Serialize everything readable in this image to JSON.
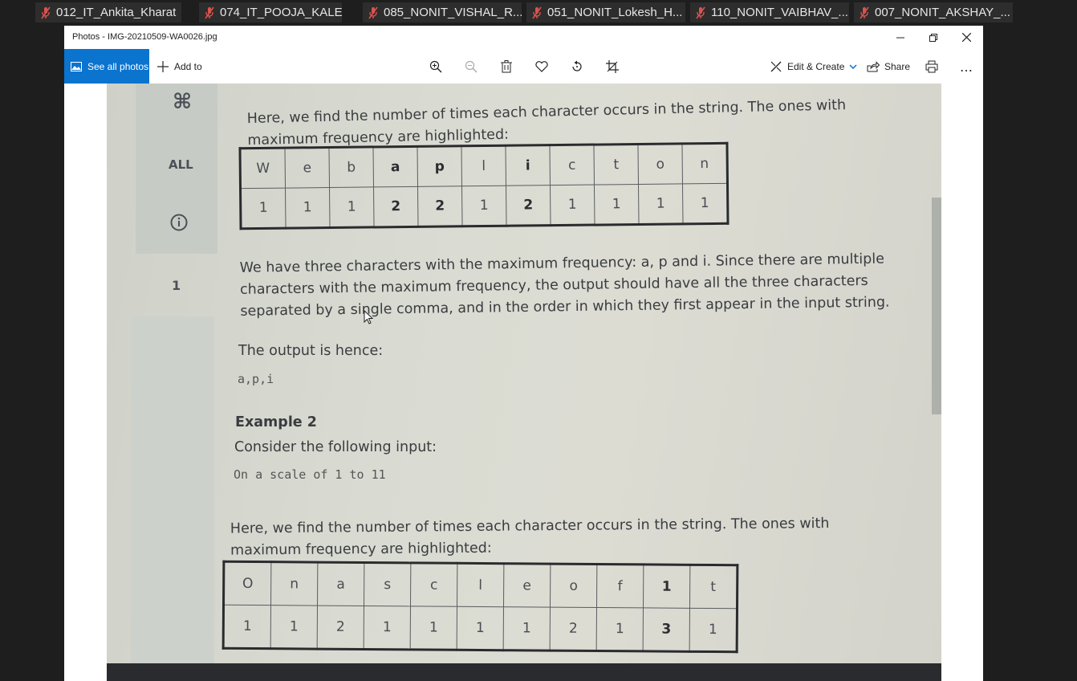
{
  "participants": [
    {
      "name": "012_IT_Ankita_Kharat"
    },
    {
      "name": "074_IT_POOJA_KALE"
    },
    {
      "name": "085_NONIT_VISHAL_R..."
    },
    {
      "name": "051_NONIT_Lokesh_H..."
    },
    {
      "name": "110_NONIT_VAIBHAV_..."
    },
    {
      "name": "007_NONIT_AKSHAY_..."
    }
  ],
  "window": {
    "title": "Photos - IMG-20210509-WA0026.jpg",
    "controls": {
      "minimize": "minimize-icon",
      "restore": "restore-icon",
      "close": "close-icon"
    }
  },
  "toolbar": {
    "see_all_photos": "See all photos",
    "add_to": "Add to",
    "edit_create": "Edit & Create",
    "share": "Share",
    "more": "…",
    "accent": "#0a74cf"
  },
  "page": {
    "sidebar": {
      "symbol": "⌘",
      "all": "ALL",
      "number": "1"
    },
    "para1": "Here, we find the number of times each character occurs in the string. The ones with maximum frequency are highlighted:",
    "table1": {
      "chars": [
        "W",
        "e",
        "b",
        "a",
        "p",
        "l",
        "i",
        "c",
        "t",
        "o",
        "n"
      ],
      "counts": [
        "1",
        "1",
        "1",
        "2",
        "2",
        "1",
        "2",
        "1",
        "1",
        "1",
        "1"
      ],
      "highlighted": [
        false,
        false,
        false,
        true,
        true,
        false,
        true,
        false,
        false,
        false,
        false
      ]
    },
    "para2": "We have three characters with the maximum frequency: a, p and i. Since there are multiple characters with the maximum frequency, the output should have all the three characters separated by a single comma, and in the order in which they first appear in the input string.",
    "para3": "The output is hence:",
    "output1": "a,p,i",
    "example2_heading": "Example 2",
    "para4": "Consider the following input:",
    "input2": "On a scale of 1 to 11",
    "para5": "Here, we find the number of times each character occurs in the string. The ones with maximum frequency are highlighted:",
    "table2": {
      "chars": [
        "O",
        "n",
        "a",
        "s",
        "c",
        "l",
        "e",
        "o",
        "f",
        "1",
        "t"
      ],
      "counts": [
        "1",
        "1",
        "2",
        "1",
        "1",
        "1",
        "1",
        "2",
        "1",
        "3",
        "1"
      ],
      "highlighted": [
        false,
        false,
        false,
        false,
        false,
        false,
        false,
        false,
        false,
        true,
        false
      ]
    }
  }
}
